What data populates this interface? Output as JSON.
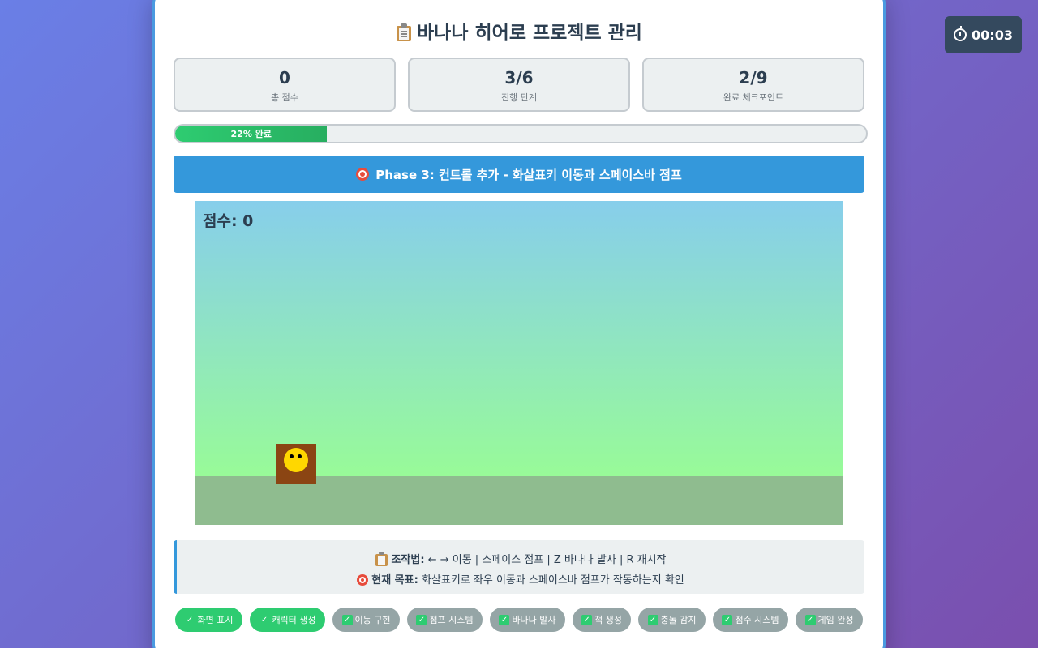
{
  "title": "바나나 히어로 프로젝트 관리",
  "stats": [
    {
      "value": "0",
      "label": "총 점수"
    },
    {
      "value": "3/6",
      "label": "진행 단계"
    },
    {
      "value": "2/9",
      "label": "완료 체크포인트"
    }
  ],
  "progress": {
    "percent": 22,
    "label": "22% 완료"
  },
  "phase": {
    "label": "Phase 3: 컨트롤 추가 - 화살표키 이동과 스페이스바 점프"
  },
  "game": {
    "score_label": "점수: 0"
  },
  "controls": {
    "controls_label": "조작법:",
    "controls_text": "← → 이동 | 스페이스 점프 | Z 바나나 발사 | R 재시작",
    "goal_label": "현재 목표:",
    "goal_text": "화살표키로 좌우 이동과 스페이스바 점프가 작동하는지 확인"
  },
  "checkpoints": [
    {
      "label": "화면 표시",
      "done": true
    },
    {
      "label": "캐릭터 생성",
      "done": true
    },
    {
      "label": "이동 구현",
      "done": false
    },
    {
      "label": "점프 시스템",
      "done": false
    },
    {
      "label": "바나나 발사",
      "done": false
    },
    {
      "label": "적 생성",
      "done": false
    },
    {
      "label": "충돌 감지",
      "done": false
    },
    {
      "label": "점수 시스템",
      "done": false
    },
    {
      "label": "게임 완성",
      "done": false
    }
  ],
  "timer": {
    "value": "00:03"
  },
  "colors": {
    "accent": "#3498db",
    "done": "#2ecc71",
    "todo": "#95a5a6",
    "player": "#8b4513",
    "face": "#ffd700"
  }
}
